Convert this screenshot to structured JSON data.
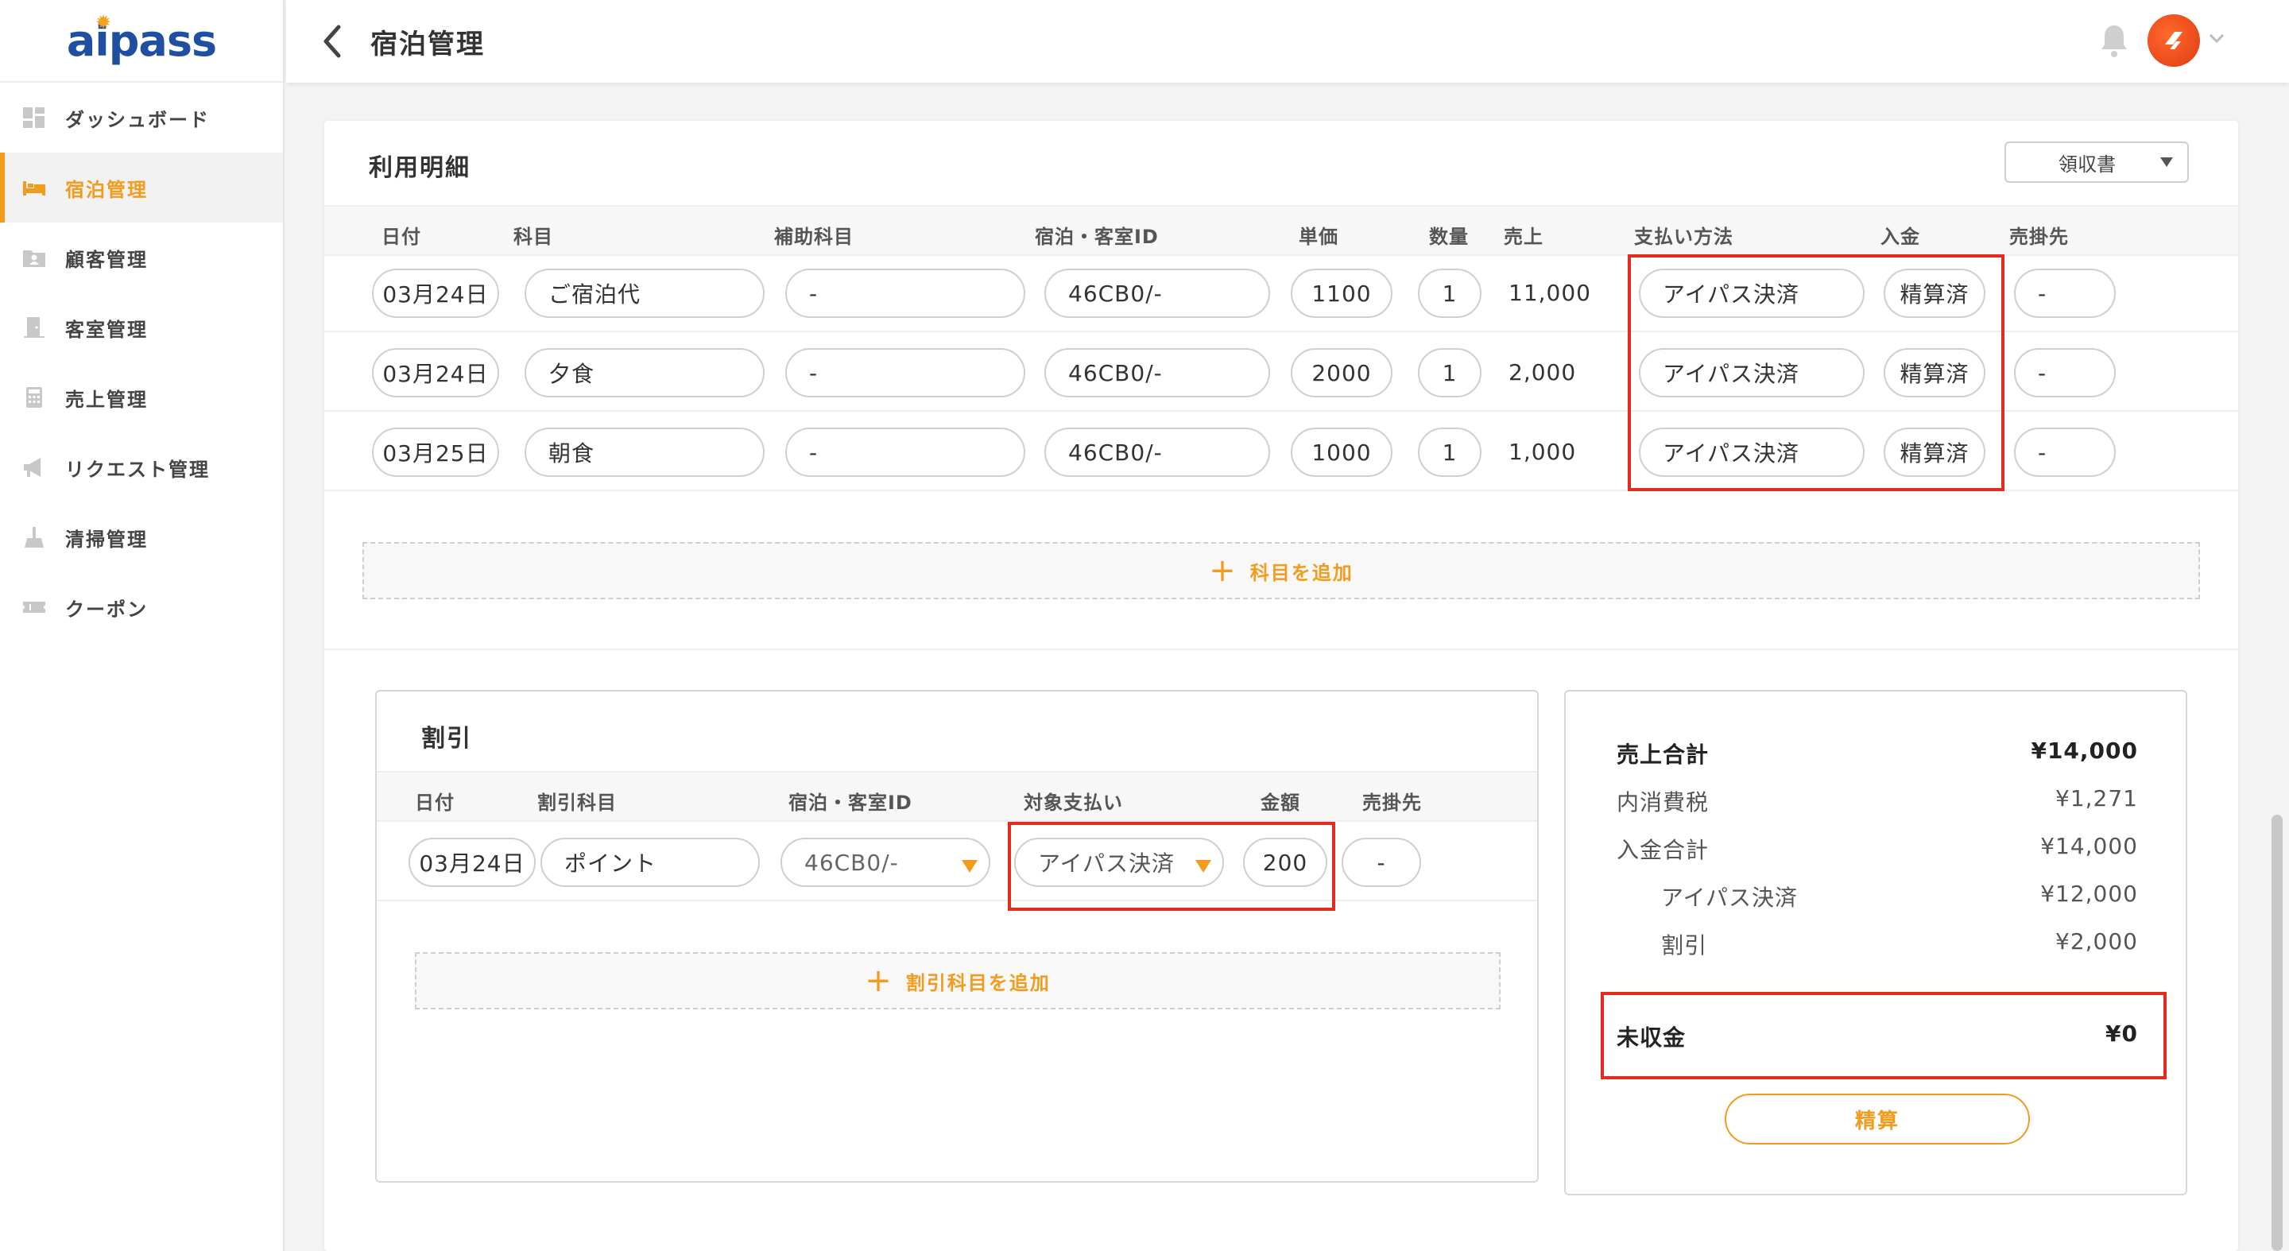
{
  "app": {
    "logo": "aipass",
    "page_title": "宿泊管理"
  },
  "sidebar": {
    "items": [
      {
        "label": "ダッシュボード",
        "icon": "dashboard-icon",
        "active": false
      },
      {
        "label": "宿泊管理",
        "icon": "bed-icon",
        "active": true
      },
      {
        "label": "顧客管理",
        "icon": "customer-icon",
        "active": false
      },
      {
        "label": "客室管理",
        "icon": "door-icon",
        "active": false
      },
      {
        "label": "売上管理",
        "icon": "calculator-icon",
        "active": false
      },
      {
        "label": "リクエスト管理",
        "icon": "megaphone-icon",
        "active": false
      },
      {
        "label": "清掃管理",
        "icon": "broom-icon",
        "active": false
      },
      {
        "label": "クーポン",
        "icon": "ticket-icon",
        "active": false
      }
    ]
  },
  "usage": {
    "title": "利用明細",
    "receipt_label": "領収書",
    "headers": {
      "date": "日付",
      "item": "科目",
      "sub_item": "補助科目",
      "stay_id": "宿泊・客室ID",
      "unit_price": "単価",
      "qty": "数量",
      "sales": "売上",
      "payment": "支払い方法",
      "deposit": "入金",
      "receivable": "売掛先"
    },
    "rows": [
      {
        "date": "03月24日",
        "item": "ご宿泊代",
        "sub_item": "-",
        "stay_id": "46CB0/-",
        "unit_price": "1100",
        "qty": "1",
        "sales": "11,000",
        "payment": "アイパス決済",
        "deposit": "精算済",
        "receivable": "-"
      },
      {
        "date": "03月24日",
        "item": "夕食",
        "sub_item": "-",
        "stay_id": "46CB0/-",
        "unit_price": "2000",
        "qty": "1",
        "sales": "2,000",
        "payment": "アイパス決済",
        "deposit": "精算済",
        "receivable": "-"
      },
      {
        "date": "03月25日",
        "item": "朝食",
        "sub_item": "-",
        "stay_id": "46CB0/-",
        "unit_price": "1000",
        "qty": "1",
        "sales": "1,000",
        "payment": "アイパス決済",
        "deposit": "精算済",
        "receivable": "-"
      }
    ],
    "add_label": "科目を追加"
  },
  "discount": {
    "title": "割引",
    "headers": {
      "date": "日付",
      "item": "割引科目",
      "stay_id": "宿泊・客室ID",
      "payment": "対象支払い",
      "amount": "金額",
      "receivable": "売掛先"
    },
    "row": {
      "date": "03月24日",
      "item": "ポイント",
      "stay_id": "46CB0/-",
      "payment": "アイパス決済",
      "amount": "200",
      "receivable": "-"
    },
    "add_label": "割引科目を追加"
  },
  "summary": {
    "sales_total_label": "売上合計",
    "sales_total": "¥14,000",
    "tax_label": "内消費税",
    "tax": "¥1,271",
    "deposit_total_label": "入金合計",
    "deposit_total": "¥14,000",
    "aipass_label": "アイパス決済",
    "aipass": "¥12,000",
    "discount_label": "割引",
    "discount": "¥2,000",
    "unpaid_label": "未収金",
    "unpaid": "¥0",
    "settle_label": "精算"
  },
  "colors": {
    "accent": "#f29b1d",
    "highlight": "#e42b1f",
    "brand": "#1f4fa0"
  }
}
